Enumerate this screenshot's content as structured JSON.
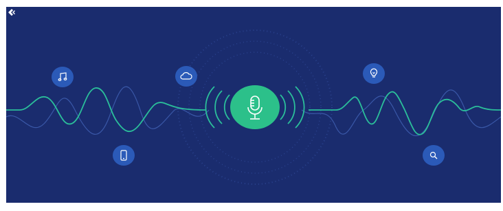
{
  "scene": {
    "background_color": "#1a2c6e",
    "wave_primary_color": "#2bbf9a",
    "wave_secondary_color": "#3a58a8",
    "center_button_color": "#2cc08a",
    "bubble_color": "#2b5ab8",
    "icons": [
      "music-note-icon",
      "cloud-icon",
      "lightbulb-icon",
      "phone-icon",
      "search-icon",
      "microphone-icon"
    ],
    "logo": "brand-logo-icon"
  }
}
